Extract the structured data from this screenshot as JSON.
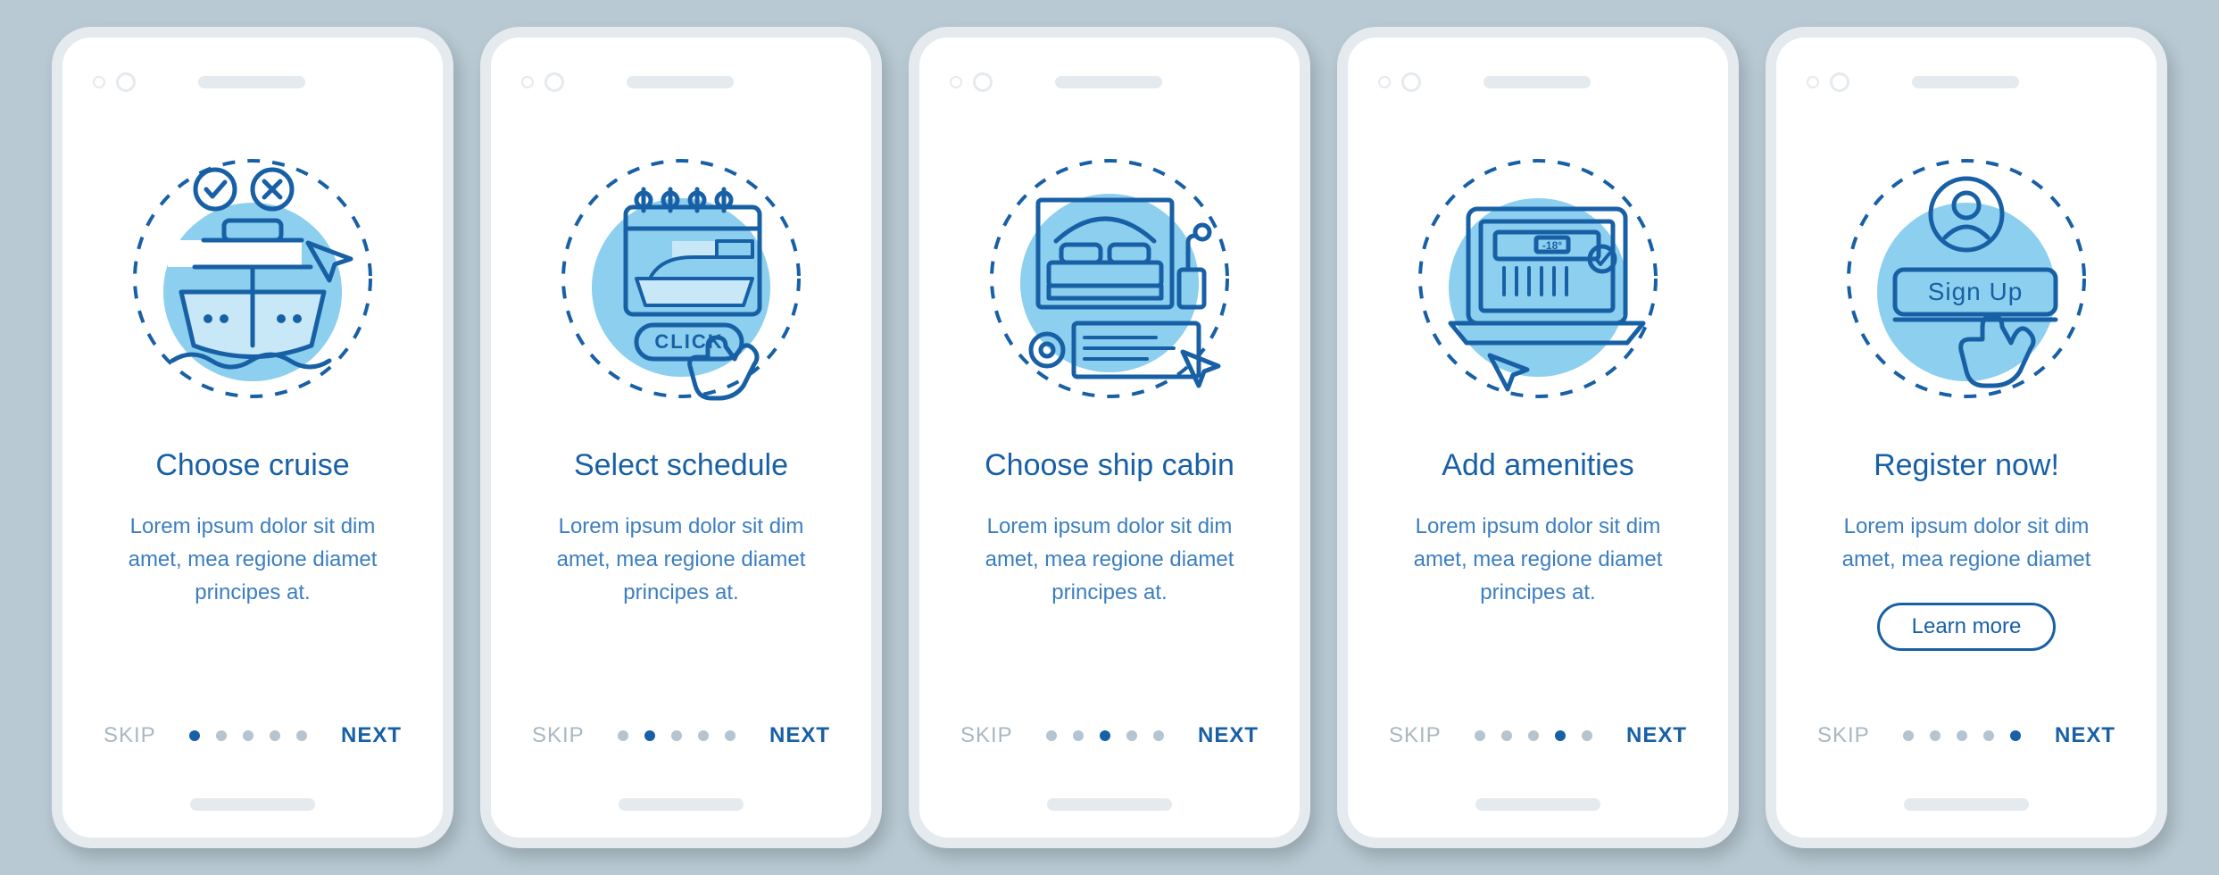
{
  "common": {
    "skip_label": "SKIP",
    "next_label": "NEXT",
    "lorem": "Lorem ipsum dolor sit dim amet, mea regione diamet principes at.",
    "dot_count": 5
  },
  "screens": [
    {
      "title": "Choose cruise",
      "body": "Lorem ipsum dolor sit dim amet, mea regione diamet principes at.",
      "active_dot": 0,
      "icon_name": "cruise-ship-icon",
      "has_learn_more": false
    },
    {
      "title": "Select schedule",
      "body": "Lorem ipsum dolor sit dim amet, mea regione diamet principes at.",
      "active_dot": 1,
      "icon_name": "calendar-click-icon",
      "click_label": "CLICK",
      "has_learn_more": false
    },
    {
      "title": "Choose ship cabin",
      "body": "Lorem ipsum dolor sit dim amet, mea regione diamet principes at.",
      "active_dot": 2,
      "icon_name": "cabin-bed-icon",
      "has_learn_more": false
    },
    {
      "title": "Add amenities",
      "body": "Lorem ipsum dolor sit dim amet, mea regione diamet principes at.",
      "active_dot": 3,
      "icon_name": "laptop-amenities-icon",
      "amenities_temp": "-18°",
      "has_learn_more": false
    },
    {
      "title": "Register now!",
      "body": "Lorem ipsum dolor sit dim amet, mea regione diamet",
      "active_dot": 4,
      "icon_name": "signup-hand-icon",
      "signup_label": "Sign Up",
      "has_learn_more": true,
      "learn_more_label": "Learn more"
    }
  ]
}
